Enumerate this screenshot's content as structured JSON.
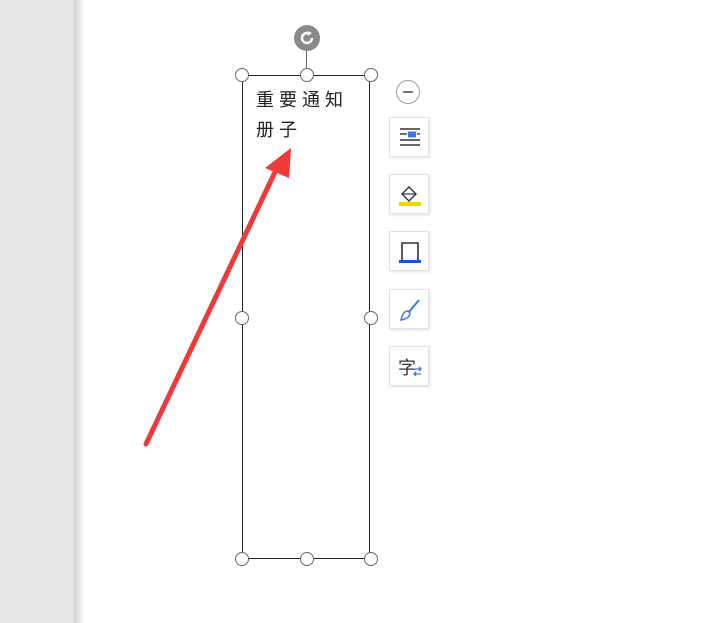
{
  "document": {
    "textbox_text": "重要通知册子"
  },
  "toolbar": {
    "items": [
      {
        "name": "layout-options",
        "icon": "text-wrap-icon"
      },
      {
        "name": "shape-fill",
        "icon": "fill-bucket-icon"
      },
      {
        "name": "shape-outline",
        "icon": "outline-icon"
      },
      {
        "name": "shape-style",
        "icon": "brush-icon"
      },
      {
        "name": "text-direction",
        "icon": "text-direction-icon"
      }
    ]
  },
  "colors": {
    "annotation_arrow": "#ee3a3a",
    "fill_accent": "#f2d600",
    "outline_accent": "#1f4fd8",
    "icon_blue": "#3b7bd8"
  }
}
